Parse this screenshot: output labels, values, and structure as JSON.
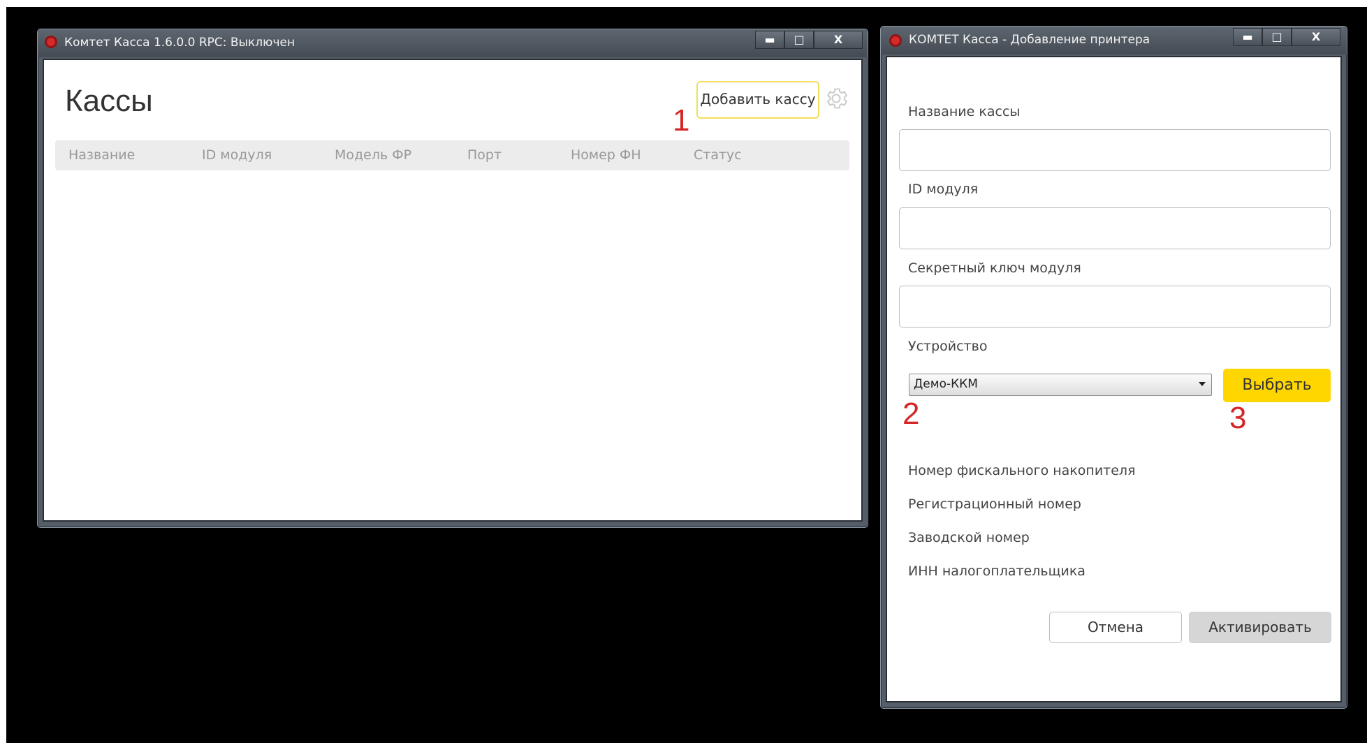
{
  "left_window": {
    "title": "Комтет Касса 1.6.0.0  RPC: Выключен",
    "controls": {
      "minimize": "▬",
      "maximize": "□",
      "close": "X"
    },
    "page_title": "Кассы",
    "add_button_label": "Добавить кассу",
    "annotation": "1",
    "columns": [
      "Название",
      "ID модуля",
      "Модель ФР",
      "Порт",
      "Номер ФН",
      "Статус"
    ]
  },
  "right_window": {
    "title": "КОМТЕТ Касса - Добавление принтера",
    "controls": {
      "minimize": "▬",
      "maximize": "□",
      "close": "X"
    },
    "fields": {
      "cash_name_label": "Название кассы",
      "cash_name_value": "",
      "module_id_label": "ID модуля",
      "module_id_value": "",
      "secret_key_label": "Секретный ключ модуля",
      "secret_key_value": "",
      "device_label": "Устройство",
      "device_selected": "Демо-ККМ"
    },
    "select_button_label": "Выбрать",
    "annotation_2": "2",
    "annotation_3": "3",
    "info": {
      "fn_number": "Номер фискального накопителя",
      "reg_number": "Регистрационный номер",
      "factory_number": "Заводской номер",
      "inn": "ИНН налогоплательщика"
    },
    "cancel_label": "Отмена",
    "activate_label": "Активировать"
  },
  "colors": {
    "accent_yellow": "#ffd600",
    "annotation_red": "#d42626",
    "icon_red": "#d42a2a"
  }
}
